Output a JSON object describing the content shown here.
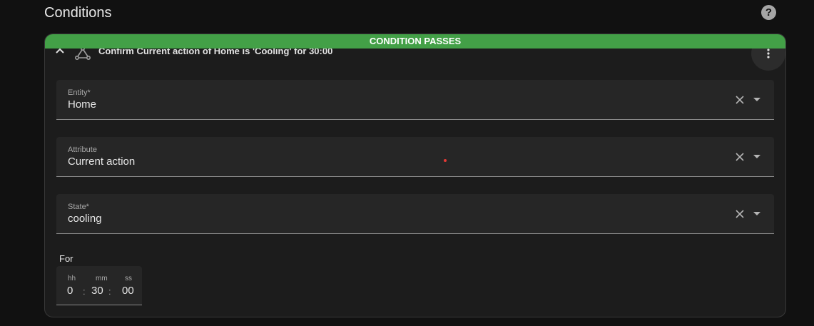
{
  "section": {
    "title": "Conditions",
    "help_icon": "help-circle-icon"
  },
  "condition": {
    "status_banner": "CONDITION PASSES",
    "summary": "Confirm Current action of Home is 'Cooling' for 30:00",
    "type_icon": "state-condition-icon",
    "collapse_icon": "chevron-up-icon",
    "menu_icon": "dots-vertical-icon",
    "banner_color": "#43a047",
    "fields": [
      {
        "label": "Entity*",
        "value": "Home"
      },
      {
        "label": "Attribute",
        "value": "Current action"
      },
      {
        "label": "State*",
        "value": "cooling"
      }
    ],
    "duration": {
      "label": "For",
      "hours_label": "hh",
      "minutes_label": "mm",
      "seconds_label": "ss",
      "hours": "0",
      "minutes": "30",
      "seconds": "00",
      "separator": ":"
    }
  }
}
